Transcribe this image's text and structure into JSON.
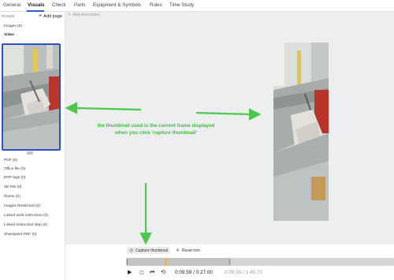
{
  "tabs": [
    {
      "label": "General"
    },
    {
      "label": "Visuals"
    },
    {
      "label": "Check"
    },
    {
      "label": "Parts"
    },
    {
      "label": "Equipment & Symbols"
    },
    {
      "label": "Rules"
    },
    {
      "label": "Time Study"
    }
  ],
  "active_tab": "Visuals",
  "sidebar": {
    "pages_label": "PAGES",
    "add_page_label": "Add page",
    "items_top": [
      {
        "label": "Images (0)"
      },
      {
        "label": "Video"
      }
    ],
    "items_bottom": [
      {
        "label": "PDF (0)"
      },
      {
        "label": "Office file (0)"
      },
      {
        "label": "ERP tags (0)"
      },
      {
        "label": "3D File (0)"
      },
      {
        "label": "Iframe (0)"
      },
      {
        "label": "Images Restricted (0)"
      },
      {
        "label": "Linked work instruction (0)"
      },
      {
        "label": "Linked instruction step (0)"
      },
      {
        "label": "Sharepoint PDF (0)"
      }
    ]
  },
  "canvas": {
    "add_description": "Add description",
    "annotation_line1": "the thumbnail used is the current frame displayed",
    "annotation_line2": "when you click 'capture thumbnail'",
    "annotation_color": "#3fbf3f"
  },
  "player": {
    "capture_label": "Capture thumbnail",
    "reset_label": "Reset trim",
    "time_current": "0:09.59 / 0:27.00",
    "time_trim": "0:09.59 / 1:45.70",
    "selection_fraction": 0.39,
    "playhead_fraction": 0.147
  },
  "icons": {
    "camera": "camera-icon",
    "close": "close-icon",
    "play": "play-icon",
    "stop": "stop-icon",
    "rewind": "rewind-icon",
    "loop": "loop-icon",
    "pencil": "pencil-icon"
  }
}
